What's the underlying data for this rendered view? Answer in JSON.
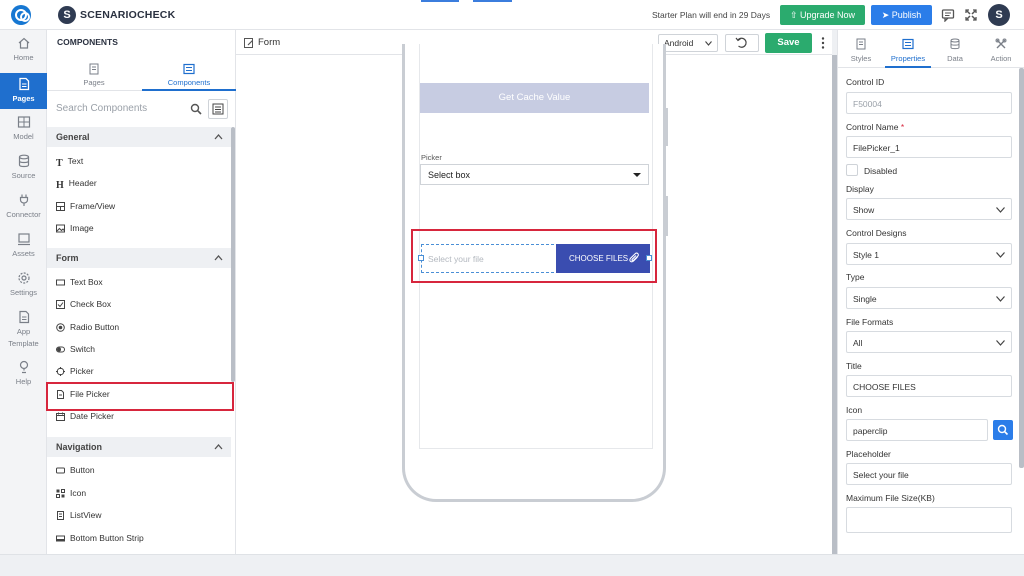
{
  "topbar": {
    "brand_letter": "S",
    "brand_name": "SCENARIOCHECK",
    "plan_text": "Starter Plan will end in 29 Days",
    "upgrade_label": "Upgrade Now",
    "publish_label": "Publish",
    "avatar_letter": "S"
  },
  "leftnav": [
    {
      "label": "Home",
      "icon": "home-icon"
    },
    {
      "label": "Pages",
      "icon": "pages-icon",
      "active": true
    },
    {
      "label": "Model",
      "icon": "model-icon"
    },
    {
      "label": "Source",
      "icon": "database-icon"
    },
    {
      "label": "Connector",
      "icon": "plug-icon"
    },
    {
      "label": "Assets",
      "icon": "assets-icon"
    },
    {
      "label": "Settings",
      "icon": "gear-icon"
    },
    {
      "label": "App",
      "label2": "Template",
      "icon": "template-icon"
    },
    {
      "label": "Help",
      "icon": "help-icon"
    }
  ],
  "components": {
    "title": "COMPONENTS",
    "tabs": [
      "Pages",
      "Components"
    ],
    "search_placeholder": "Search Components",
    "sections": {
      "general": {
        "title": "General",
        "items": [
          "Text",
          "Header",
          "Frame/View",
          "Image"
        ]
      },
      "form": {
        "title": "Form",
        "items": [
          "Text Box",
          "Check Box",
          "Radio Button",
          "Switch",
          "Picker",
          "File Picker",
          "Date Picker"
        ]
      },
      "navigation": {
        "title": "Navigation",
        "items": [
          "Button",
          "Icon",
          "ListView",
          "Bottom Button Strip"
        ]
      }
    }
  },
  "canvas": {
    "form_title": "Form",
    "platform": "Android",
    "save_label": "Save",
    "cache_button": "Get Cache Value",
    "picker_label": "Picker",
    "picker_value": "Select box",
    "file_placeholder": "Select your file",
    "file_button": "CHOOSE FILES"
  },
  "properties": {
    "tabs": [
      "Styles",
      "Properties",
      "Data",
      "Action"
    ],
    "control_id_label": "Control ID",
    "control_id_value": "F50004",
    "control_name_label": "Control Name",
    "control_name_value": "FilePicker_1",
    "disabled_label": "Disabled",
    "display_label": "Display",
    "display_value": "Show",
    "designs_label": "Control Designs",
    "designs_value": "Style 1",
    "type_label": "Type",
    "type_value": "Single",
    "formats_label": "File Formats",
    "formats_value": "All",
    "title_label": "Title",
    "title_value": "CHOOSE FILES",
    "icon_label": "Icon",
    "icon_value": "paperclip",
    "placeholder_label": "Placeholder",
    "placeholder_value": "Select your file",
    "maxsize_label": "Maximum File Size(KB)"
  },
  "colors": {
    "primary": "#1f6fce",
    "upgrade": "#2bab6e",
    "publish": "#2b7de9",
    "file_button": "#3a4db0",
    "highlight": "#d7263d"
  }
}
